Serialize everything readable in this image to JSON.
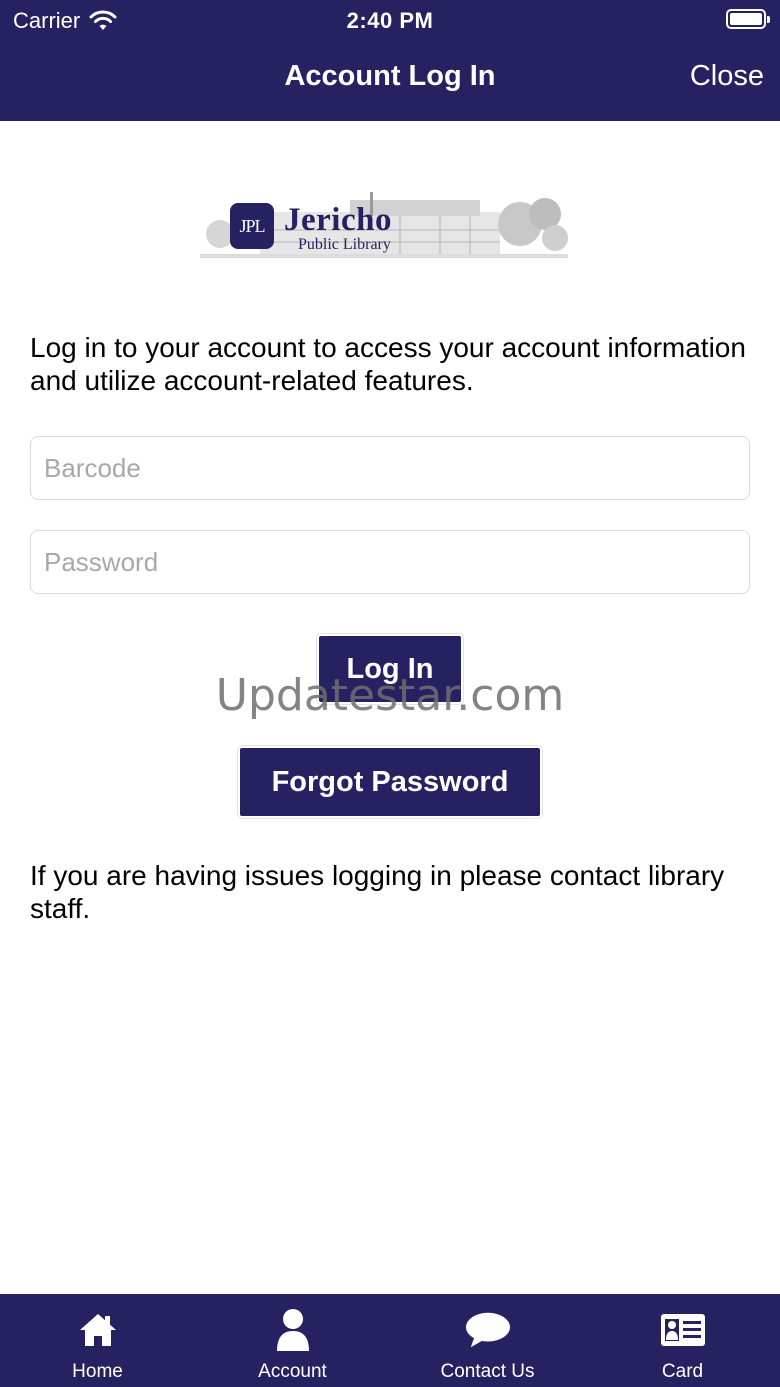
{
  "status_bar": {
    "carrier": "Carrier",
    "time": "2:40 PM",
    "icons": [
      "wifi-icon",
      "battery-icon"
    ]
  },
  "nav": {
    "title": "Account Log In",
    "close_label": "Close"
  },
  "logo": {
    "mark": "JPL",
    "name": "Jericho",
    "subtitle": "Public Library"
  },
  "intro_text": "Log in to your account to access your account information and utilize account-related features.",
  "form": {
    "barcode": {
      "value": "",
      "placeholder": "Barcode"
    },
    "password": {
      "value": "",
      "placeholder": "Password"
    },
    "login_label": "Log In",
    "forgot_label": "Forgot Password"
  },
  "help_text": "If you are having issues logging in please contact library staff.",
  "watermark": "Updatestar.com",
  "tabbar": {
    "items": [
      {
        "label": "Home",
        "icon": "home-icon"
      },
      {
        "label": "Account",
        "icon": "person-icon"
      },
      {
        "label": "Contact Us",
        "icon": "chat-bubble-icon"
      },
      {
        "label": "Card",
        "icon": "id-card-icon"
      }
    ]
  },
  "colors": {
    "brand": "#262262",
    "background": "#ffffff",
    "placeholder": "#a8a8a8",
    "field_border": "#d9d9d9"
  }
}
